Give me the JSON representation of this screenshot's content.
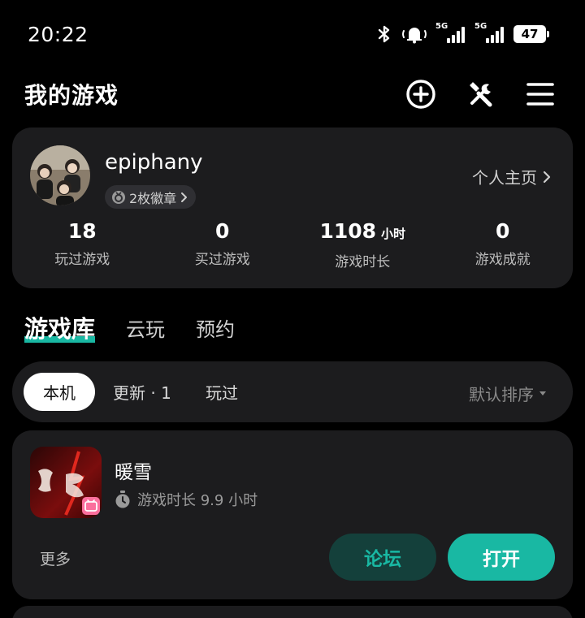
{
  "status_bar": {
    "time": "20:22",
    "network_1": "5G",
    "network_2": "5G",
    "battery": "47"
  },
  "header": {
    "title": "我的游戏",
    "icons": [
      "add-circle-icon",
      "tools-icon",
      "menu-icon"
    ]
  },
  "profile": {
    "username": "epiphany",
    "badges": "2枚徽章",
    "profile_link": "个人主页",
    "stats": [
      {
        "value": "18",
        "unit": "",
        "label": "玩过游戏"
      },
      {
        "value": "0",
        "unit": "",
        "label": "买过游戏"
      },
      {
        "value": "1108",
        "unit": "小时",
        "label": "游戏时长"
      },
      {
        "value": "0",
        "unit": "",
        "label": "游戏成就"
      }
    ]
  },
  "library_tabs": [
    {
      "label": "游戏库",
      "active": true
    },
    {
      "label": "云玩",
      "active": false
    },
    {
      "label": "预约",
      "active": false
    }
  ],
  "filters": {
    "items": [
      "本机",
      "更新 · 1",
      "玩过"
    ],
    "active": "本机",
    "sort_label": "默认排序"
  },
  "game": {
    "name": "暖雪",
    "playtime": "游戏时长 9.9 小时",
    "more": "更多",
    "forum_button": "论坛",
    "open_button": "打开"
  },
  "colors": {
    "accent": "#19b8a3",
    "card_bg": "#1c1c1e",
    "page_bg": "#000000"
  }
}
